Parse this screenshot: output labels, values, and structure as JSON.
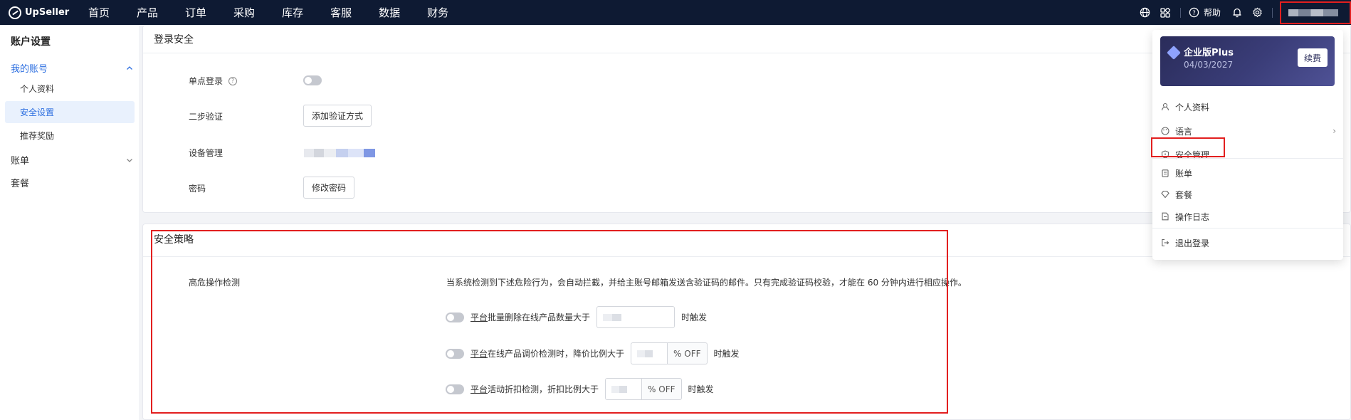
{
  "brand": {
    "name": "UpSeller"
  },
  "topnav": {
    "items": [
      "首页",
      "产品",
      "订单",
      "采购",
      "库存",
      "客服",
      "数据",
      "财务"
    ],
    "help_label": "帮助",
    "icons": [
      "globe-icon",
      "apps-icon",
      "help-icon",
      "bell-icon",
      "gear-icon"
    ]
  },
  "sidebar": {
    "title": "账户设置",
    "my_account": "我的账号",
    "profile": "个人资料",
    "security": "安全设置",
    "referral": "推荐奖励",
    "billing": "账单",
    "plan": "套餐"
  },
  "login_security": {
    "title": "登录安全",
    "sso_label": "单点登录",
    "two_step_label": "二步验证",
    "add_method_button": "添加验证方式",
    "device_label": "设备管理",
    "password_label": "密码",
    "change_password_button": "修改密码"
  },
  "security_policy": {
    "title": "安全策略",
    "risk_label": "高危操作检测",
    "description": "当系统检测到下述危险行为，会自动拦截，并给主账号邮箱发送含验证码的邮件。只有完成验证码校验，才能在 60 分钟内进行相应操作。",
    "platform": "平台",
    "rule1_text": "批量删除在线产品数量大于",
    "rule2_text": "在线产品调价检测时，降价比例大于",
    "rule3_text": "活动折扣检测，折扣比例大于",
    "suffix": "% OFF",
    "trigger": "时触发"
  },
  "dropdown": {
    "plan_name": "企业版Plus",
    "plan_date": "04/03/2027",
    "renew": "续费",
    "profile": "个人资料",
    "language": "语言",
    "security": "安全管理",
    "billing": "账单",
    "plan": "套餐",
    "logs": "操作日志",
    "logout": "退出登录"
  },
  "colors": {
    "topbar": "#0e1a33",
    "accent": "#2d6fe0",
    "highlight": "#e21f1f"
  }
}
